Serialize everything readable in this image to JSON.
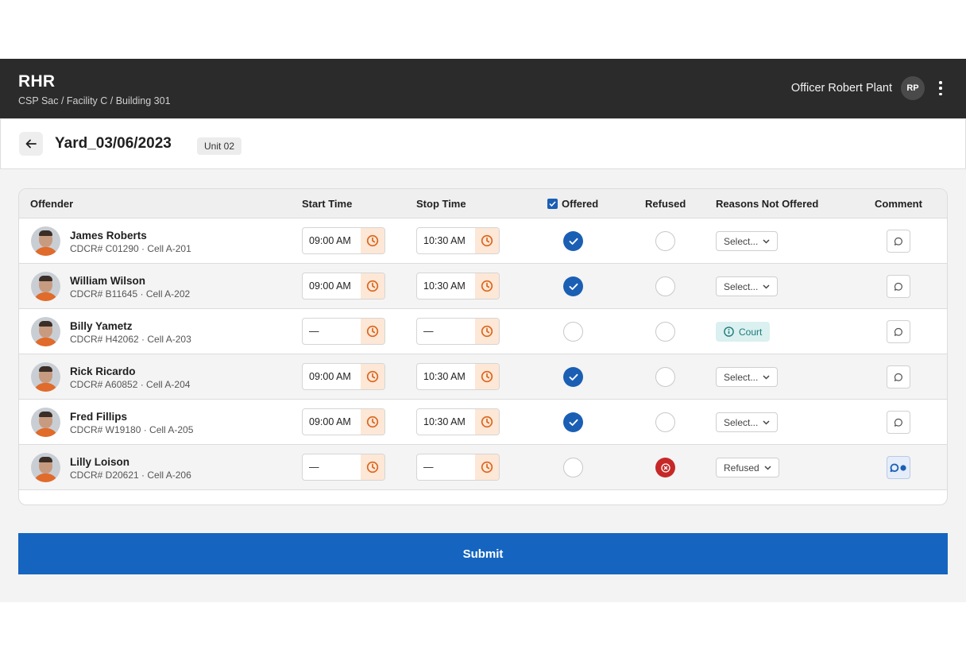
{
  "header": {
    "app_title": "RHR",
    "breadcrumb": "CSP Sac / Facility C / Building 301",
    "officer_name": "Officer Robert Plant",
    "officer_initials": "RP"
  },
  "subheader": {
    "page_title": "Yard_03/06/2023",
    "unit": "Unit 02"
  },
  "table": {
    "columns": {
      "offender": "Offender",
      "start_time": "Start Time",
      "stop_time": "Stop Time",
      "offered": "Offered",
      "refused": "Refused",
      "reasons": "Reasons Not Offered",
      "comment": "Comment"
    },
    "rows": [
      {
        "name": "James Roberts",
        "meta": "CDCR# C01290  ·  Cell A-201",
        "start": "09:00 AM",
        "stop": "10:30 AM",
        "offered": true,
        "refused": false,
        "reason": "Select...",
        "reason_type": "select",
        "comment_active": false
      },
      {
        "name": "William Wilson",
        "meta": "CDCR# B11645  ·  Cell A-202",
        "start": "09:00 AM",
        "stop": "10:30 AM",
        "offered": true,
        "refused": false,
        "reason": "Select...",
        "reason_type": "select",
        "comment_active": false
      },
      {
        "name": "Billy Yametz",
        "meta": "CDCR# H42062  ·  Cell A-203",
        "start": "—",
        "stop": "—",
        "offered": false,
        "refused": false,
        "reason": "Court",
        "reason_type": "badge",
        "comment_active": false
      },
      {
        "name": "Rick Ricardo",
        "meta": "CDCR# A60852  ·  Cell A-204",
        "start": "09:00 AM",
        "stop": "10:30 AM",
        "offered": true,
        "refused": false,
        "reason": "Select...",
        "reason_type": "select",
        "comment_active": false
      },
      {
        "name": "Fred Fillips",
        "meta": "CDCR# W19180  ·  Cell A-205",
        "start": "09:00 AM",
        "stop": "10:30 AM",
        "offered": true,
        "refused": false,
        "reason": "Select...",
        "reason_type": "select",
        "comment_active": false
      },
      {
        "name": "Lilly Loison",
        "meta": "CDCR# D20621  ·  Cell A-206",
        "start": "—",
        "stop": "—",
        "offered": false,
        "refused": true,
        "reason": "Refused",
        "reason_type": "select",
        "comment_active": true
      }
    ]
  },
  "actions": {
    "submit_label": "Submit"
  },
  "colors": {
    "accent": "#1565c0",
    "refused": "#c62828",
    "clock": "#d9661f",
    "court_text": "#1c7b7b"
  }
}
